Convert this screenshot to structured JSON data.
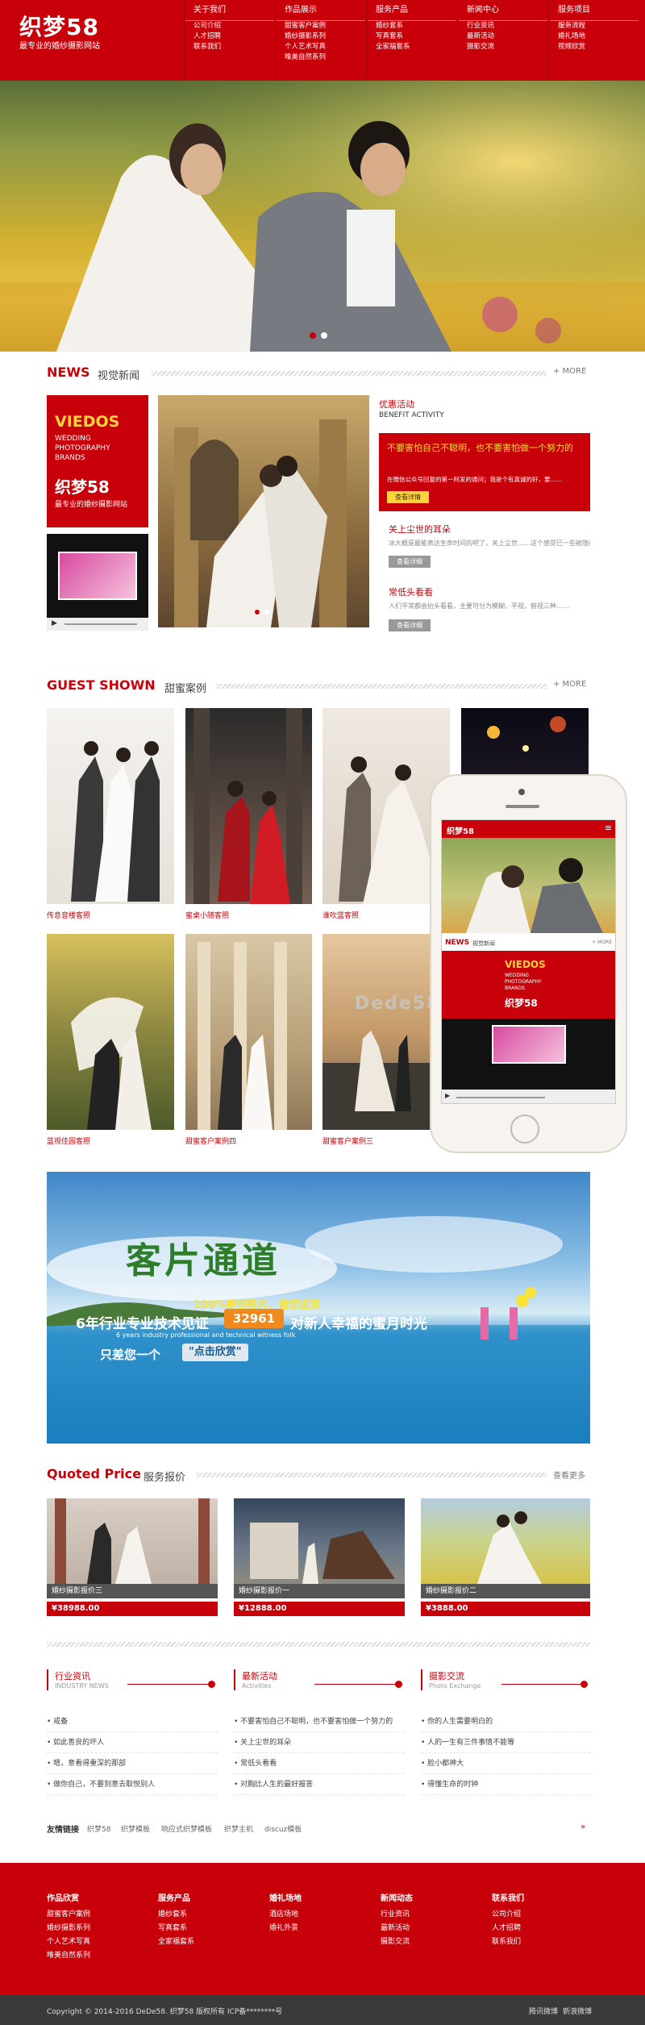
{
  "header": {
    "logo": "织梦58",
    "tagline": "最专业的婚纱摄影网站",
    "nav": [
      {
        "title": "关于我们",
        "links": [
          "公司介绍",
          "人才招聘",
          "联系我们"
        ]
      },
      {
        "title": "作品展示",
        "links": [
          "甜蜜客户案例",
          "婚纱摄影系列",
          "个人艺术写真",
          "唯美自然系列"
        ]
      },
      {
        "title": "服务产品",
        "links": [
          "婚纱套系",
          "写真套系",
          "全家福套系"
        ]
      },
      {
        "title": "新闻中心",
        "links": [
          "行业资讯",
          "最新活动",
          "摄影交流"
        ]
      },
      {
        "title": "服务项目",
        "links": [
          "服务流程",
          "婚礼场地",
          "视频欣赏"
        ]
      }
    ]
  },
  "news": {
    "title": "NEWS",
    "subtitle": "视觉新闻",
    "more": "+ MORE",
    "promo": {
      "brand": "VIEDOS",
      "lines": [
        "WEDDING",
        "PHOTOGRAPHY",
        "BRANDS"
      ],
      "logo": "织梦58",
      "slogan": "最专业的婚纱摄影网站"
    },
    "benefit_title": "优惠活动",
    "benefit_en": "BENEFIT ACTIVITY",
    "featured": {
      "title": "不要害怕自己不聪明，也不要害怕做一个努力的",
      "desc": "在微信公众号回复的第一阿发的通问；我是个有真诚的好，要……",
      "btn": "查看详情"
    },
    "items": [
      {
        "title": "关上尘世的耳朵",
        "desc": "冰大概是最能表达生命时间的吧了，关上尘世……这个感觉已一些被隐蔽",
        "btn": "查看详细"
      },
      {
        "title": "常低头看看",
        "desc": "人们平常都会抬头看看，主要可分为模糊，平视，俯视三种……",
        "btn": "查看详细"
      }
    ]
  },
  "guest": {
    "title": "GUEST SHOWN",
    "subtitle": "甜蜜案例",
    "more": "+ MORE",
    "captions": [
      "传息音楼客照",
      "蜜桌小随客照",
      "谁吹蓝客照",
      "蓝视佳园客照",
      "甜蜜客户案例四",
      "甜蜜客户案例三"
    ]
  },
  "phone": {
    "logo": "织梦58",
    "news": "NEWS",
    "news_sub": "视觉新闻",
    "more": "+ MORE",
    "brand": "VIEDOS",
    "lines": [
      "WEDDING",
      "PHOTOGRAPHY",
      "BRANDS"
    ],
    "logo2": "织梦58"
  },
  "watermark": "Dede58.com",
  "banner": {
    "title": "客片通道",
    "line1": "100%原创客片，邀您鉴赏",
    "line2a": "6年行业专业技术见证",
    "count": "32961",
    "line2b": "对新人幸福的蜜月时光",
    "line3": "6 years industry professional and technical witness folk",
    "line4": "只差您一个",
    "button": "\"点击欣赏\""
  },
  "price": {
    "title": "Quoted Price",
    "subtitle": "服务报价",
    "more": "查看更多",
    "items": [
      {
        "name": "婚纱摄影报价三",
        "price": "¥38988.00"
      },
      {
        "name": "婚纱摄影报价一",
        "price": "¥12888.00"
      },
      {
        "name": "婚纱摄影报价二",
        "price": "¥3888.00"
      }
    ]
  },
  "columns": [
    {
      "title": "行业资讯",
      "sub": "INDUSTRY NEWS",
      "items": [
        "戒备",
        "如此善良的坏人",
        "嗯，意看得重深的那部",
        "做你自己，不要刻意去取悦别人"
      ]
    },
    {
      "title": "最新活动",
      "sub": "Activities",
      "items": [
        "不要害怕自己不聪明，也不要害怕做一个努力的",
        "关上尘世的耳朵",
        "常低头看看",
        "对胸比人生的最好报答"
      ]
    },
    {
      "title": "摄影交流",
      "sub": "Photo Exchange",
      "items": [
        "你的人生需要明白的",
        "人的一生有三件事情不能等",
        "脸小都神大",
        "得懂生命的时钟"
      ]
    }
  ],
  "links": {
    "label": "友情链接",
    "items": [
      "织梦58",
      "织梦模板",
      "响应式织梦模板",
      "织梦主机",
      "discuz模板"
    ],
    "arrow": "»"
  },
  "footer": {
    "cols": [
      {
        "title": "作品欣赏",
        "items": [
          "甜蜜客户案例",
          "婚纱摄影系列",
          "个人艺术写真",
          "唯美自然系列"
        ]
      },
      {
        "title": "服务产品",
        "items": [
          "婚纱套系",
          "写真套系",
          "全家福套系"
        ]
      },
      {
        "title": "婚礼场地",
        "items": [
          "酒店场地",
          "婚礼外景"
        ]
      },
      {
        "title": "新闻动态",
        "items": [
          "行业资讯",
          "最新活动",
          "摄影交流"
        ]
      },
      {
        "title": "联系我们",
        "items": [
          "公司介绍",
          "人才招聘",
          "联系我们"
        ]
      }
    ],
    "copyright": "Copyright © 2014-2016 DeDe58. 织梦58 版权所有 ICP备********号",
    "social": [
      "腾讯微博",
      "新浪微博"
    ]
  },
  "colors": {
    "brand": "#c8000a",
    "dark": "#3a3a3a"
  }
}
